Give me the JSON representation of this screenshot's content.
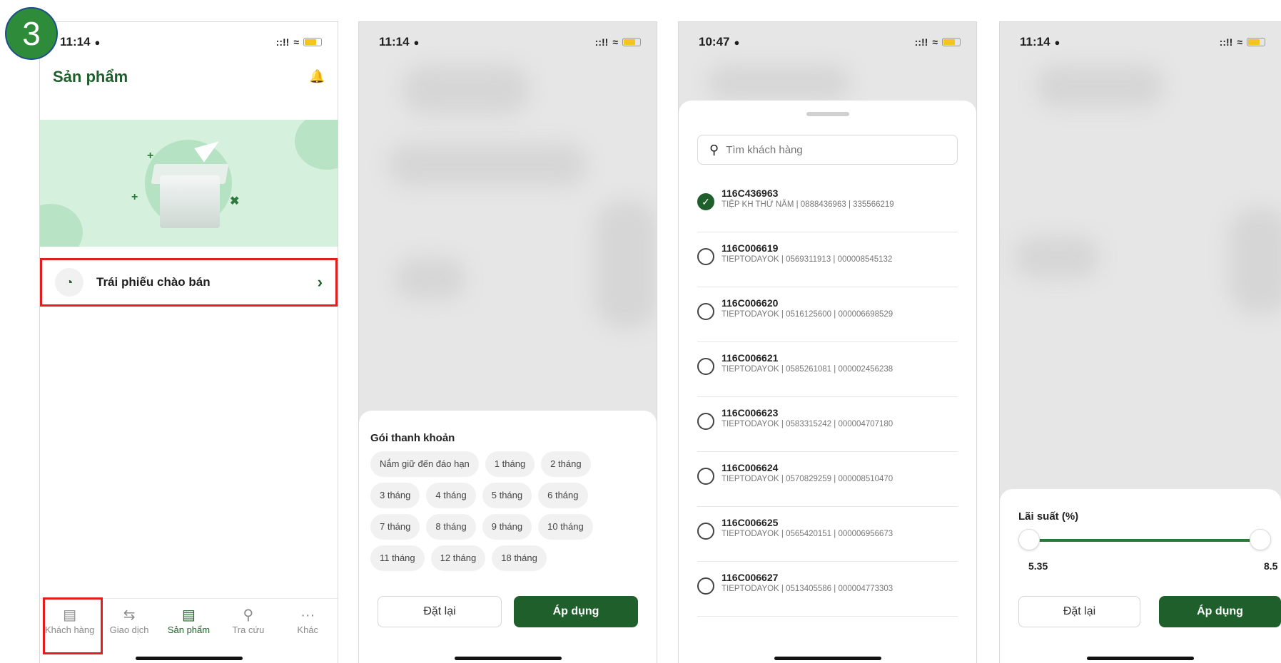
{
  "step_number": "3",
  "screen1": {
    "status": {
      "time": "11:14",
      "signal": "::!!"
    },
    "title": "Sản phẩm",
    "product_item": {
      "label": "Trái phiếu chào bán"
    },
    "tabs": [
      {
        "label": "Khách hàng",
        "icon": "customer-icon"
      },
      {
        "label": "Giao dịch",
        "icon": "transfer-icon"
      },
      {
        "label": "Sản phẩm",
        "icon": "product-icon"
      },
      {
        "label": "Tra cứu",
        "icon": "search-icon"
      },
      {
        "label": "Khác",
        "icon": "more-icon"
      }
    ]
  },
  "screen2": {
    "status": {
      "time": "11:14",
      "signal": "::!!"
    },
    "section_title": "Gói thanh khoản",
    "chips": [
      "Nắm giữ đến đáo hạn",
      "1 tháng",
      "2 tháng",
      "3 tháng",
      "4 tháng",
      "5 tháng",
      "6 tháng",
      "7 tháng",
      "8 tháng",
      "9 tháng",
      "10 tháng",
      "11 tháng",
      "12 tháng",
      "18 tháng"
    ],
    "reset_label": "Đặt lại",
    "apply_label": "Áp dụng"
  },
  "screen3": {
    "status": {
      "time": "10:47",
      "signal": "::!!"
    },
    "search_placeholder": "Tìm khách hàng",
    "customers": [
      {
        "id": "116C436963",
        "details": "TIỆP KH THỨ NĂM | 0888436963 | 335566219",
        "selected": true
      },
      {
        "id": "116C006619",
        "details": "TIEPTODAYOK | 0569311913 | 000008545132",
        "selected": false
      },
      {
        "id": "116C006620",
        "details": "TIEPTODAYOK | 0516125600 | 000006698529",
        "selected": false
      },
      {
        "id": "116C006621",
        "details": "TIEPTODAYOK | 0585261081 | 000002456238",
        "selected": false
      },
      {
        "id": "116C006623",
        "details": "TIEPTODAYOK | 0583315242 | 000004707180",
        "selected": false
      },
      {
        "id": "116C006624",
        "details": "TIEPTODAYOK | 0570829259 | 000008510470",
        "selected": false
      },
      {
        "id": "116C006625",
        "details": "TIEPTODAYOK | 0565420151 | 000006956673",
        "selected": false
      },
      {
        "id": "116C006627",
        "details": "TIEPTODAYOK | 0513405586 | 000004773303",
        "selected": false
      }
    ]
  },
  "screen4": {
    "status": {
      "time": "11:14",
      "signal": "::!!"
    },
    "section_title": "Lãi suất (%)",
    "min_value": "5.35",
    "max_value": "8.5",
    "reset_label": "Đặt lại",
    "apply_label": "Áp dụng"
  },
  "colors": {
    "brand_green": "#1f5f2c",
    "highlight_red": "#e11d1d",
    "banner_green": "#d6f0de"
  }
}
